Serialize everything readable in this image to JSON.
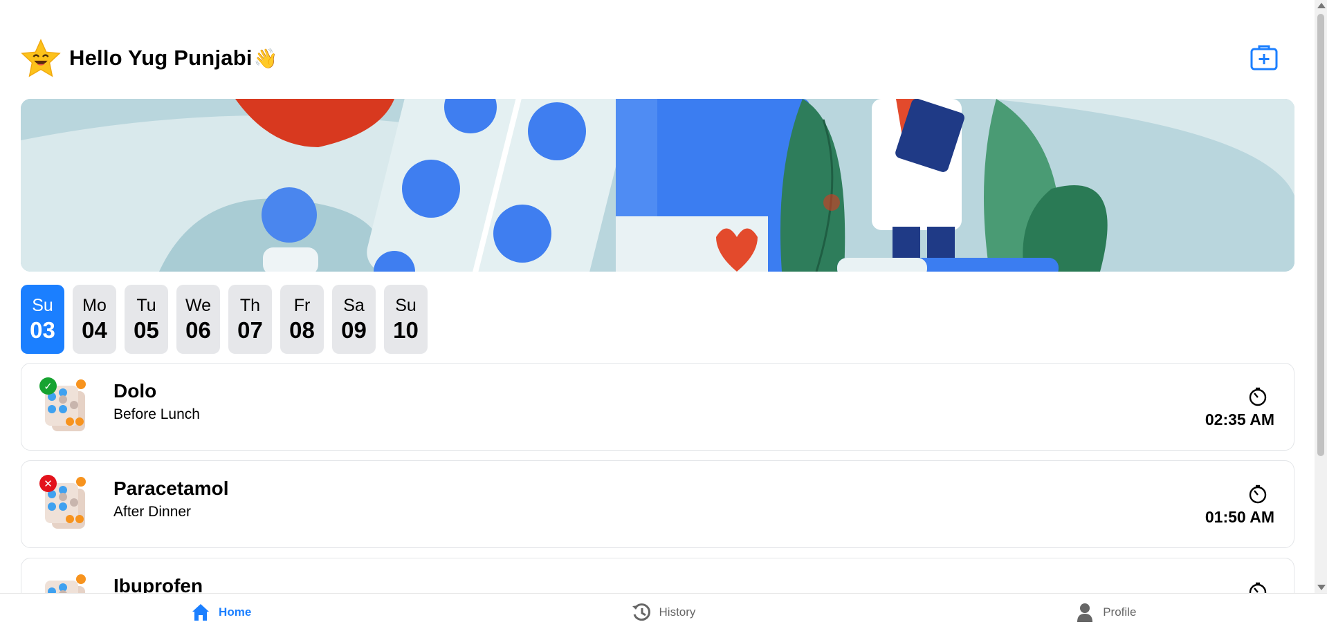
{
  "header": {
    "greeting": "Hello Yug Punjabi",
    "wave_emoji": "👋",
    "avatar_icon": "star-face-icon",
    "add_icon": "add-medication-icon"
  },
  "colors": {
    "primary": "#1b7fff",
    "day_bg": "#e6e7ea",
    "taken": "#17a331",
    "missed": "#e3121b"
  },
  "days": [
    {
      "name": "Su",
      "num": "03",
      "active": true
    },
    {
      "name": "Mo",
      "num": "04",
      "active": false
    },
    {
      "name": "Tu",
      "num": "05",
      "active": false
    },
    {
      "name": "We",
      "num": "06",
      "active": false
    },
    {
      "name": "Th",
      "num": "07",
      "active": false
    },
    {
      "name": "Fr",
      "num": "08",
      "active": false
    },
    {
      "name": "Sa",
      "num": "09",
      "active": false
    },
    {
      "name": "Su",
      "num": "10",
      "active": false
    }
  ],
  "medications": [
    {
      "name": "Dolo",
      "when": "Before Lunch",
      "time": "02:35 AM",
      "status": "taken",
      "status_glyph": "✓"
    },
    {
      "name": "Paracetamol",
      "when": "After Dinner",
      "time": "01:50 AM",
      "status": "missed",
      "status_glyph": "✕"
    },
    {
      "name": "Ibuprofen",
      "when": "",
      "time": "",
      "status": "",
      "status_glyph": ""
    }
  ],
  "nav": [
    {
      "label": "Home",
      "icon": "home-icon",
      "active": true
    },
    {
      "label": "History",
      "icon": "history-icon",
      "active": false
    },
    {
      "label": "Profile",
      "icon": "profile-icon",
      "active": false
    }
  ]
}
